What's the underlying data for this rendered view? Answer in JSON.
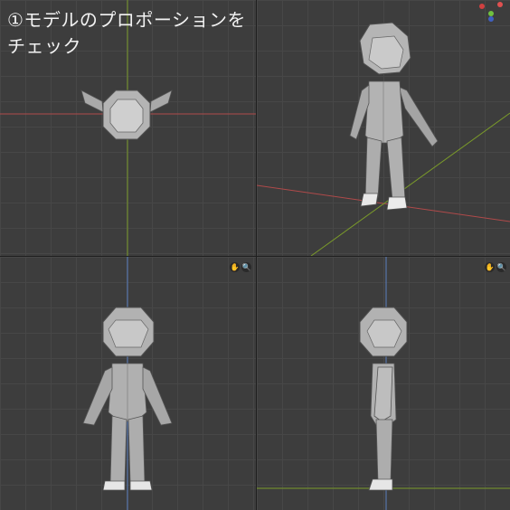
{
  "title": "①モデルのプロポーションをチェック",
  "viewports": {
    "top": {
      "name": "top-view"
    },
    "perspective": {
      "name": "perspective-view"
    },
    "front": {
      "name": "front-view",
      "nav": {
        "hand": "✋",
        "zoom": "🔍"
      }
    },
    "side": {
      "name": "side-view",
      "nav": {
        "hand": "✋",
        "zoom": "🔍"
      }
    }
  },
  "colors": {
    "x_axis": "#b04a4a",
    "y_axis": "#7a9a2a",
    "z_axis": "#5a7fc0",
    "mesh_fill": "#b8b8b8",
    "mesh_edge": "#555555"
  },
  "gizmo": {
    "icons": [
      "x-axis-dot",
      "y-axis-dot",
      "z-axis-dot"
    ]
  }
}
